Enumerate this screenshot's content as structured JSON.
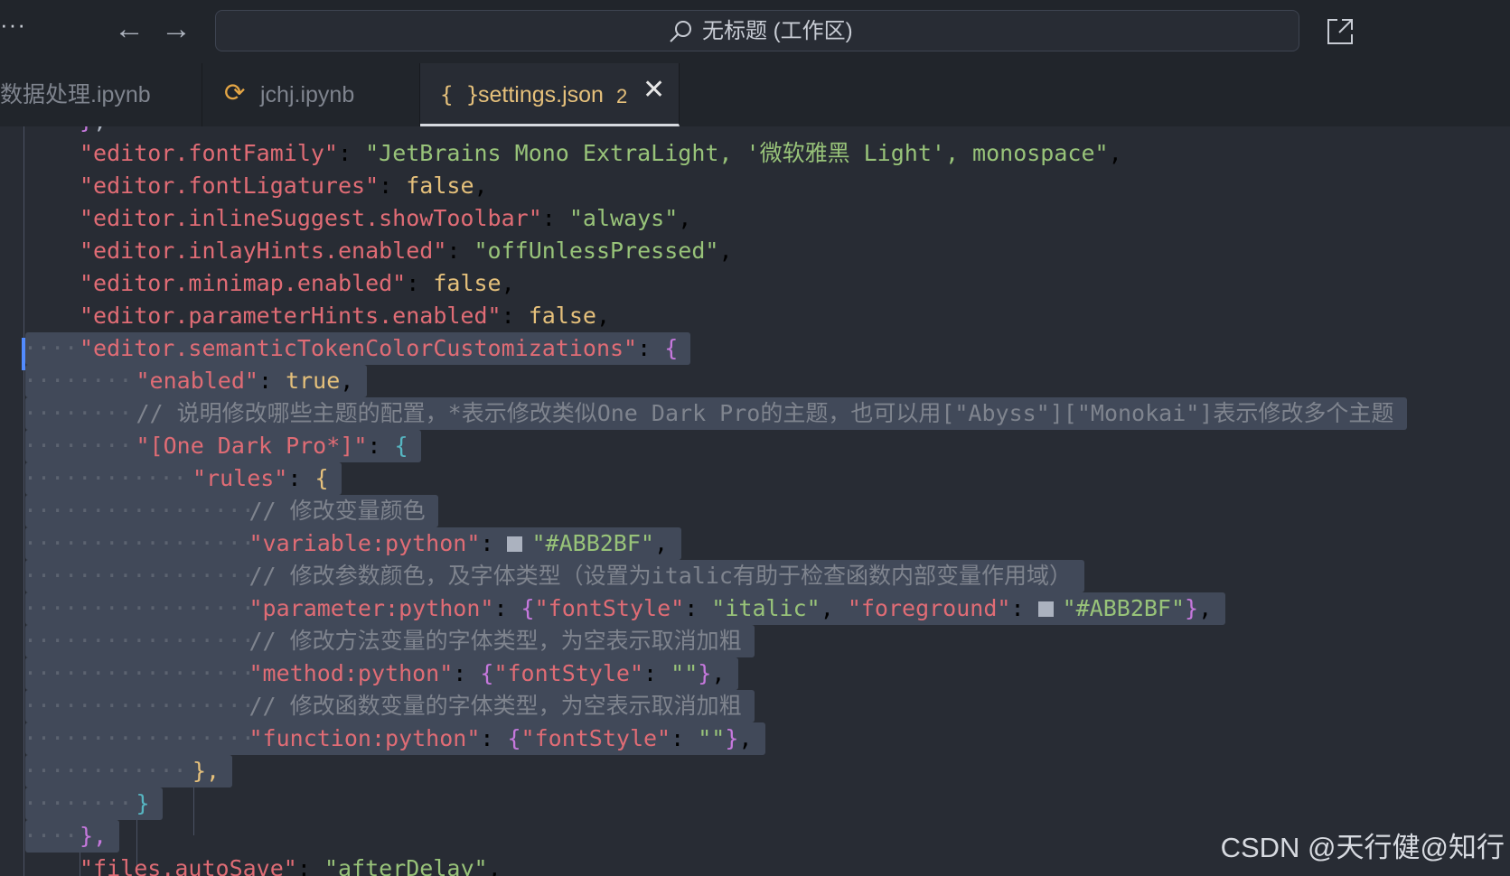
{
  "titlebar": {
    "more_glyph": "···",
    "back_glyph": "←",
    "forward_glyph": "→",
    "command_center_label": "无标题 (工作区)",
    "icons": [
      "ellipsis-icon",
      "arrow-left-icon",
      "arrow-right-icon",
      "search-icon",
      "open-external-icon"
    ]
  },
  "tabs": [
    {
      "label": "数据处理.ipynb",
      "active": false
    },
    {
      "label": "jchj.ipynb",
      "icon_glyph": "⟳",
      "active": false
    },
    {
      "label": "settings.json",
      "icon_glyph": "{ }",
      "badge": "2",
      "close_glyph": "✕",
      "active": true
    }
  ],
  "colors": {
    "editor_bg": "#282c34",
    "titlebar_bg": "#21252b",
    "selection_bg": "#414959",
    "property_key": "#e06c75",
    "string": "#98c379",
    "keyword": "#e5c07b",
    "comment": "#7f848e",
    "bracket_level_1": "#c678dd",
    "bracket_level_2": "#56b6c2",
    "bracket_level_3": "#e5c07b"
  },
  "editor": {
    "lines": [
      {
        "key": "\"editor.fontFamily\"",
        "value": "\"JetBrains Mono ExtraLight, '微软雅黑 Light', monospace\""
      },
      {
        "key": "\"editor.fontLigatures\"",
        "value": "false"
      },
      {
        "key": "\"editor.inlineSuggest.showToolbar\"",
        "value": "\"always\""
      },
      {
        "key": "\"editor.inlayHints.enabled\"",
        "value": "\"offUnlessPressed\""
      },
      {
        "key": "\"editor.minimap.enabled\"",
        "value": "false"
      },
      {
        "key": "\"editor.parameterHints.enabled\"",
        "value": "false"
      },
      {
        "key": "\"editor.semanticTokenColorCustomizations\"",
        "value": "{"
      },
      {
        "key": "\"enabled\"",
        "value": "true"
      },
      {
        "comment": "// 说明修改哪些主题的配置，*表示修改类似One Dark Pro的主题，也可以用[\"Abyss\"][\"Monokai\"]表示修改多个主题"
      },
      {
        "key": "\"[One Dark Pro*]\"",
        "value": "{"
      },
      {
        "key": "\"rules\"",
        "value": "{"
      },
      {
        "comment": "// 修改变量颜色"
      },
      {
        "key": "\"variable:python\"",
        "value": "\"#ABB2BF\"",
        "swatch": "#ABB2BF"
      },
      {
        "comment": "// 修改参数颜色，及字体类型（设置为italic有助于检查函数内部变量作用域）"
      },
      {
        "key": "\"parameter:python\"",
        "k2": "\"fontStyle\"",
        "v2": "\"italic\"",
        "k3": "\"foreground\"",
        "v3": "\"#ABB2BF\"",
        "swatch": "#ABB2BF"
      },
      {
        "comment": "// 修改方法变量的字体类型，为空表示取消加粗"
      },
      {
        "key": "\"method:python\"",
        "k2": "\"fontStyle\"",
        "v2": "\"\""
      },
      {
        "comment": "// 修改函数变量的字体类型，为空表示取消加粗"
      },
      {
        "key": "\"function:python\"",
        "k2": "\"fontStyle\"",
        "v2": "\"\""
      },
      {
        "close": "},"
      },
      {
        "close": "}"
      },
      {
        "close": "},"
      },
      {
        "key": "\"files.autoSave\"",
        "value": "\"afterDelay\""
      }
    ]
  },
  "watermark": "CSDN @天行健@知行"
}
